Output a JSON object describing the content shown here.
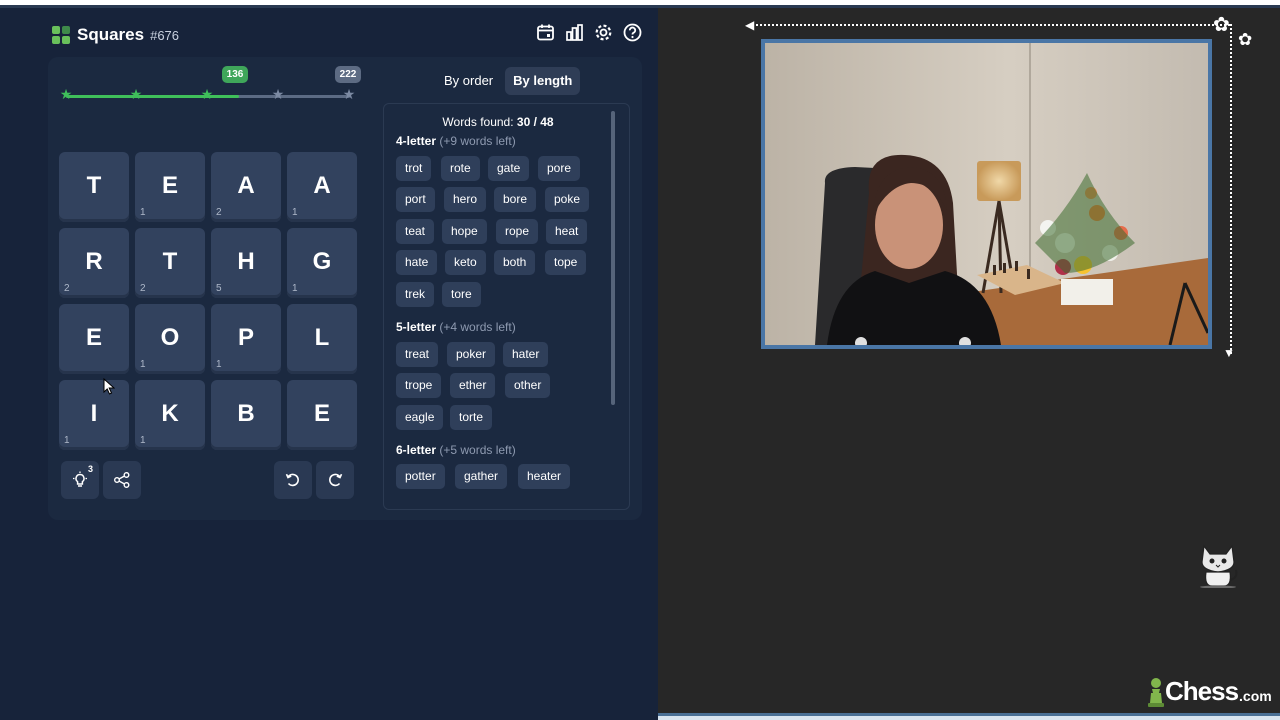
{
  "app": {
    "title": "Squares",
    "issue": "#676",
    "icons": [
      "calendar-icon",
      "stats-icon",
      "settings-icon",
      "help-icon"
    ]
  },
  "progress": {
    "current_score": "136",
    "max_score": "222",
    "stars_total": 5,
    "stars_earned": 3,
    "fill_fraction": 0.61,
    "colors": {
      "earned": "#3fbf5a",
      "remaining": "#7c8aa3"
    }
  },
  "grid": {
    "tiles": [
      {
        "letter": "T",
        "count": ""
      },
      {
        "letter": "E",
        "count": "1"
      },
      {
        "letter": "A",
        "count": "2"
      },
      {
        "letter": "A",
        "count": "1"
      },
      {
        "letter": "R",
        "count": "2"
      },
      {
        "letter": "T",
        "count": "2"
      },
      {
        "letter": "H",
        "count": "5"
      },
      {
        "letter": "G",
        "count": "1"
      },
      {
        "letter": "E",
        "count": ""
      },
      {
        "letter": "O",
        "count": "1"
      },
      {
        "letter": "P",
        "count": "1"
      },
      {
        "letter": "L",
        "count": ""
      },
      {
        "letter": "I",
        "count": "1"
      },
      {
        "letter": "K",
        "count": "1"
      },
      {
        "letter": "B",
        "count": ""
      },
      {
        "letter": "E",
        "count": ""
      }
    ]
  },
  "tools": {
    "hints_remaining": "3",
    "icons": [
      "hint-icon",
      "share-icon",
      "undo-icon",
      "redo-icon"
    ]
  },
  "sort": {
    "by_order": "By order",
    "by_length": "By length",
    "active": "By length"
  },
  "words": {
    "found_label": "Words found: ",
    "found_value": "30 / 48",
    "sections": [
      {
        "title": "4-letter",
        "left": "(+9 words left)",
        "words": [
          "trot",
          "rote",
          "gate",
          "pore",
          "port",
          "hero",
          "bore",
          "poke",
          "teat",
          "hope",
          "rope",
          "heat",
          "hate",
          "keto",
          "both",
          "tope",
          "trek",
          "tore"
        ]
      },
      {
        "title": "5-letter",
        "left": "(+4 words left)",
        "words": [
          "treat",
          "poker",
          "hater",
          "trope",
          "ether",
          "other",
          "eagle",
          "torte"
        ]
      },
      {
        "title": "6-letter",
        "left": "(+5 words left)",
        "words": [
          "potter",
          "gather",
          "heater"
        ]
      }
    ]
  },
  "branding": {
    "name": "Chess",
    "domain": ".com"
  },
  "theme": {
    "page_bg": "#17233a",
    "tile_bg": "#32425e",
    "accent_green": "#3fbf5a",
    "stream_bg": "#272727",
    "webcam_border": "#4a76a6"
  }
}
